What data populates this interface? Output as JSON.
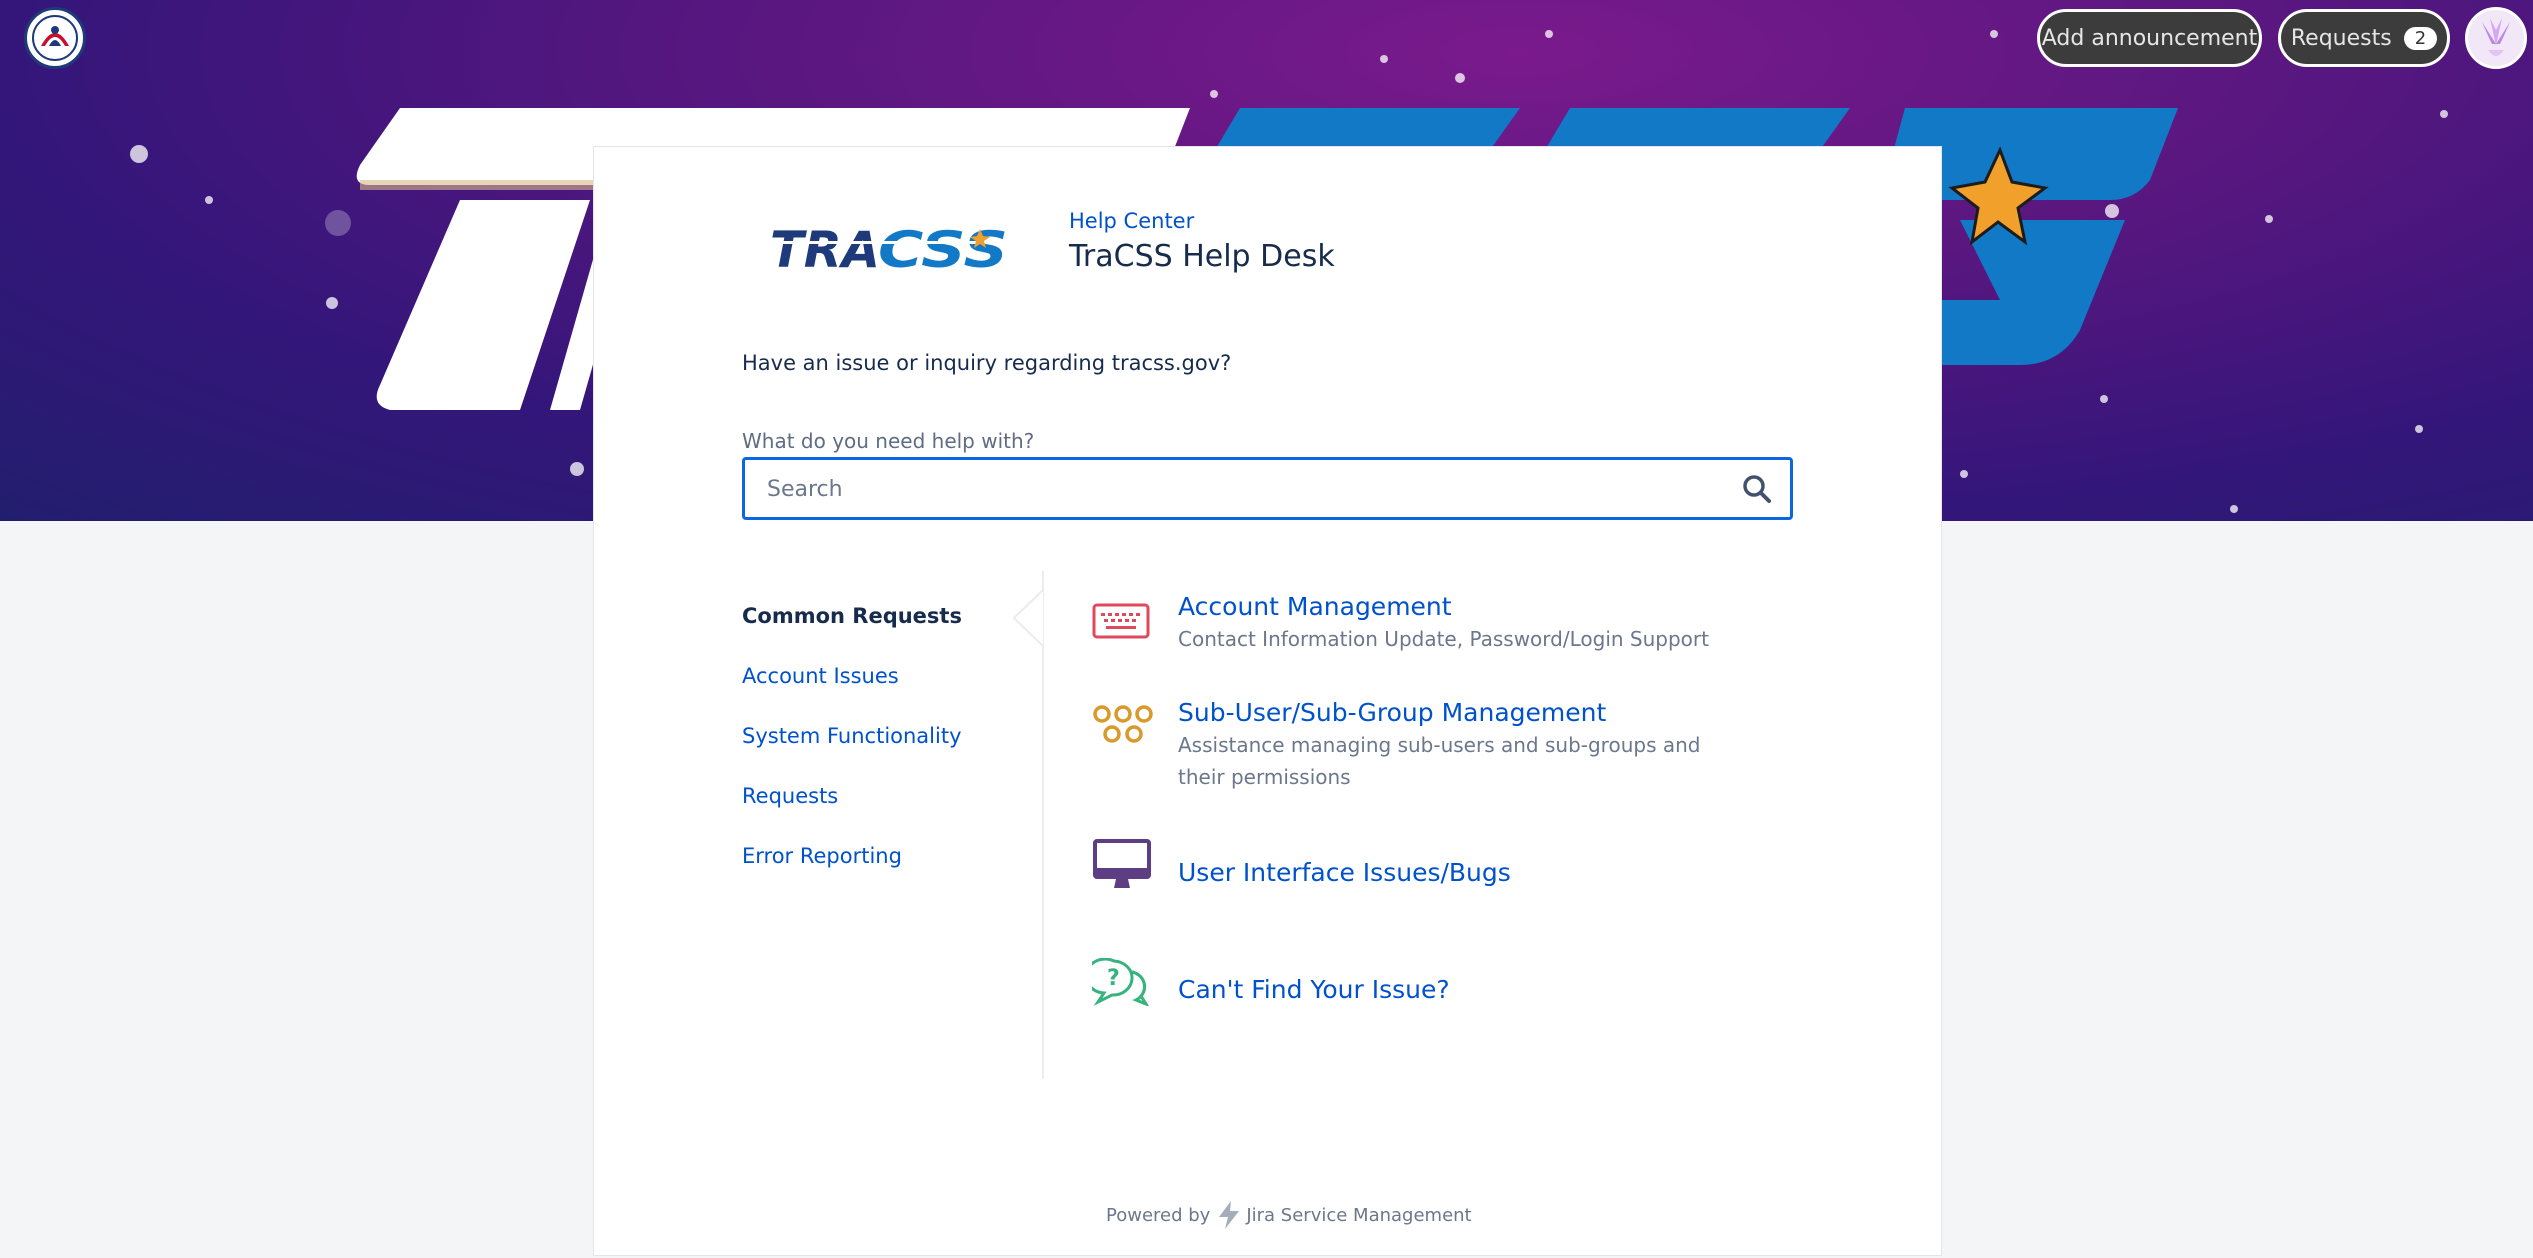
{
  "header": {
    "add_announcement_label": "Add announcement",
    "requests_label": "Requests",
    "requests_count": "2"
  },
  "portal": {
    "breadcrumb": "Help Center",
    "title": "TraCSS Help Desk",
    "logo_text": "TRACSS",
    "intro": "Have an issue or inquiry regarding tracss.gov?",
    "search_label": "What do you need help with?",
    "search_placeholder": "Search"
  },
  "sidebar": {
    "items": [
      {
        "label": "Common Requests",
        "active": true
      },
      {
        "label": "Account Issues"
      },
      {
        "label": "System Functionality"
      },
      {
        "label": "Requests"
      },
      {
        "label": "Error Reporting"
      }
    ]
  },
  "request_types": [
    {
      "title": "Account Management",
      "description": "Contact Information Update, Password/Login Support",
      "icon": "keyboard-icon"
    },
    {
      "title": "Sub-User/Sub-Group Management",
      "description": "Assistance managing sub-users and sub-groups and their permissions",
      "icon": "group-icon"
    },
    {
      "title": "User Interface Issues/Bugs",
      "description": "",
      "icon": "monitor-icon"
    },
    {
      "title": "Can't Find Your Issue?",
      "description": "",
      "icon": "question-chat-icon"
    }
  ],
  "footer": {
    "powered_by": "Powered by",
    "product": "Jira Service Management"
  },
  "colors": {
    "link": "#0052cc",
    "text": "#172b4d",
    "muted": "#6b778c",
    "search_border": "#0c66e4",
    "hero_purple": "#5a1780"
  }
}
